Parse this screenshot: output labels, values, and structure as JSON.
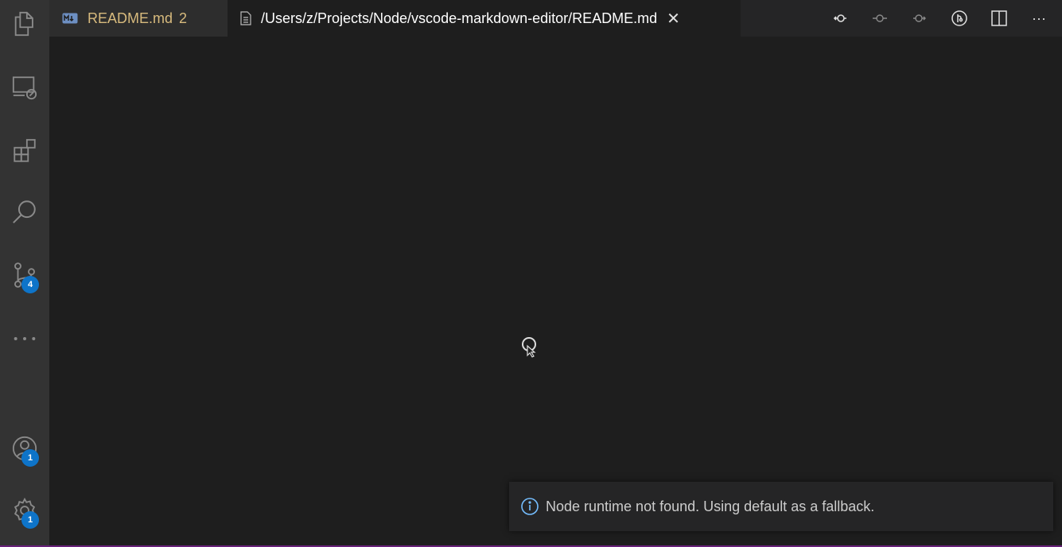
{
  "activity_bar": {
    "items": [
      {
        "name": "explorer",
        "icon": "files-icon"
      },
      {
        "name": "remote-explorer",
        "icon": "remote-explorer-icon"
      },
      {
        "name": "extensions",
        "icon": "extensions-icon"
      },
      {
        "name": "search",
        "icon": "search-icon"
      },
      {
        "name": "source-control",
        "icon": "source-control-icon",
        "badge": "4"
      },
      {
        "name": "more",
        "icon": "ellipsis-icon"
      },
      {
        "name": "accounts",
        "icon": "account-icon",
        "badge": "1"
      },
      {
        "name": "manage",
        "icon": "gear-icon",
        "badge": "1"
      }
    ]
  },
  "tabs": [
    {
      "label": "README.md",
      "count": "2",
      "icon": "markdown-icon",
      "active": false
    },
    {
      "label": "/Users/z/Projects/Node/vscode-markdown-editor/README.md",
      "icon": "file-icon",
      "active": true,
      "close": "✕"
    }
  ],
  "toolbar": {
    "items": [
      "go-back-icon",
      "timeline-icon",
      "go-forward-icon",
      "open-changes-icon",
      "split-editor-icon",
      "more-actions-icon"
    ],
    "more_label": "···"
  },
  "notification": {
    "icon": "info-icon",
    "message": "Node runtime not found. Using default as a fallback."
  },
  "colors": {
    "activity_bar": "#333333",
    "editor": "#1e1e1e",
    "badge": "#0e74c9",
    "modified_tab_text": "#d7ba7d",
    "info_icon": "#75beff"
  }
}
